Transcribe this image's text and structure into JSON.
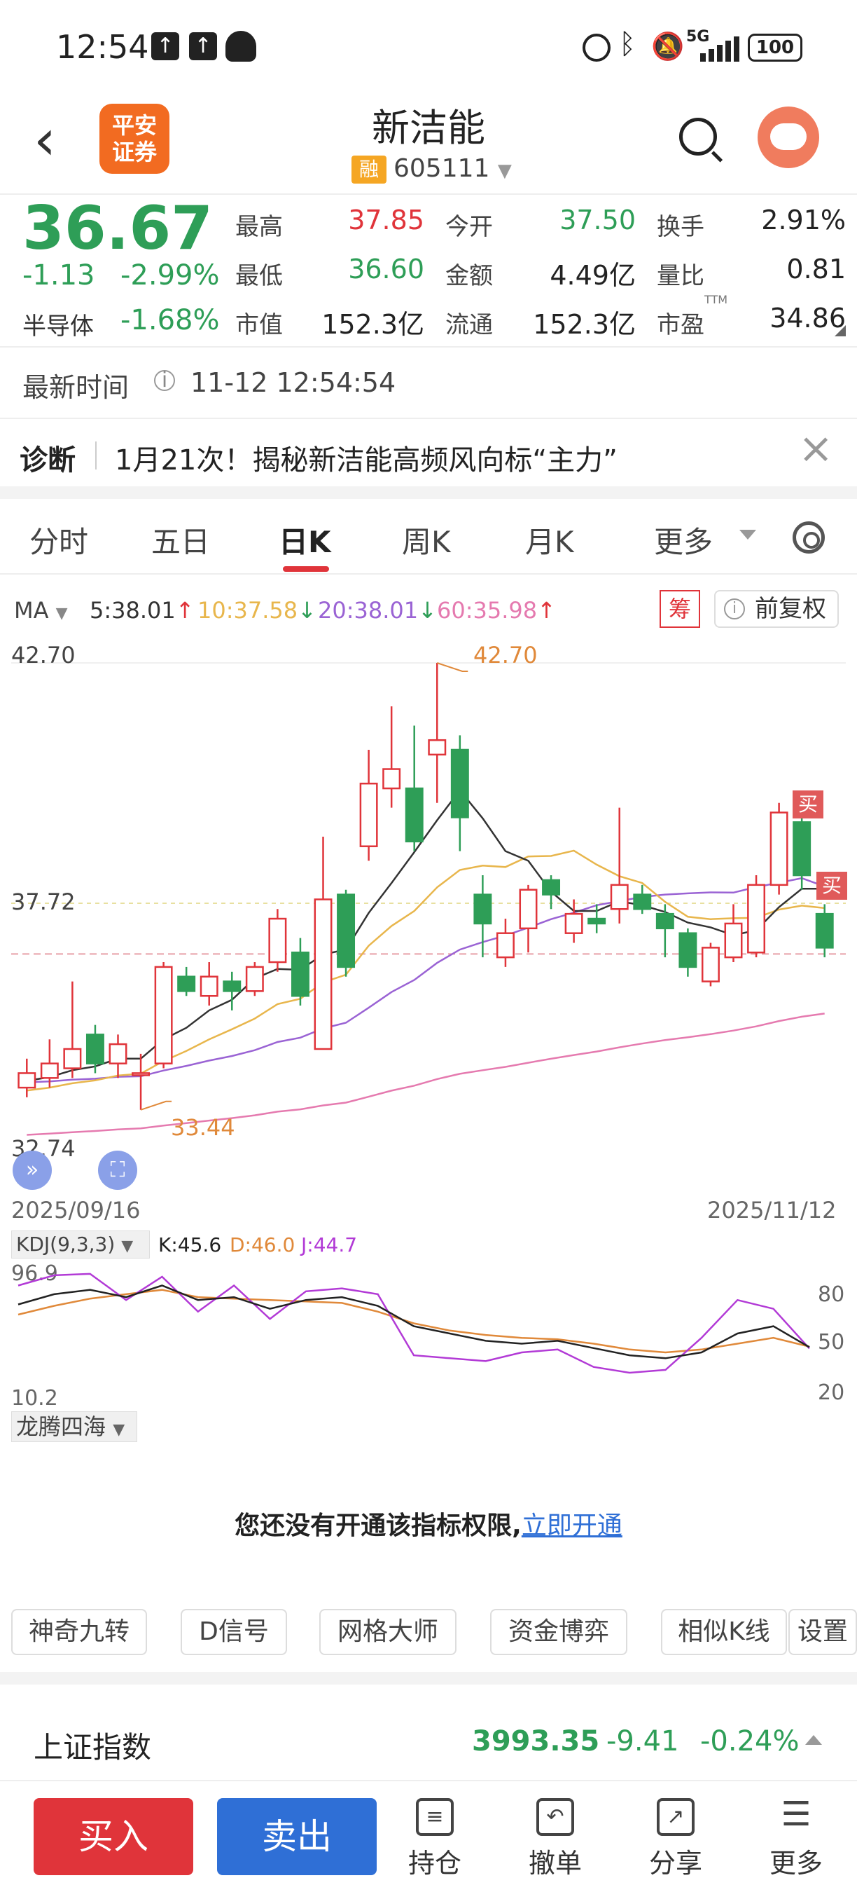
{
  "status_bar": {
    "time": "12:54",
    "icons": [
      "upload-icon",
      "upload-icon",
      "qq-icon",
      "alarm-icon",
      "bluetooth-icon",
      "mute-icon",
      "signal-icon"
    ],
    "network": "5G",
    "battery": "100"
  },
  "header": {
    "logo_text": "平安\n证券",
    "stock_name": "新洁能",
    "margin_badge": "融",
    "stock_code": "605111"
  },
  "quote": {
    "price": "36.67",
    "change": "-1.13",
    "change_pct": "-2.99%",
    "sector_name": "半导体",
    "sector_pct": "-1.68%",
    "fields": [
      {
        "label": "最高",
        "value": "37.85",
        "color": "red"
      },
      {
        "label": "今开",
        "value": "37.50",
        "color": "green"
      },
      {
        "label": "换手",
        "value": "2.91%",
        "color": "black"
      },
      {
        "label": "最低",
        "value": "36.60",
        "color": "green"
      },
      {
        "label": "金额",
        "value": "4.49亿",
        "color": "black"
      },
      {
        "label": "量比",
        "value": "0.81",
        "color": "black"
      },
      {
        "label": "市值",
        "value": "152.3亿",
        "color": "black"
      },
      {
        "label": "流通",
        "value": "152.3亿",
        "color": "black"
      },
      {
        "label": "市盈",
        "value": "34.86",
        "color": "black"
      }
    ],
    "pe_sup": "TTM"
  },
  "latest": {
    "label": "最新时间",
    "info_icon": "ⓘ",
    "time": "11-12 12:54:54"
  },
  "diagnosis": {
    "label": "诊断",
    "text": "1月21次！揭秘新洁能高频风向标“主力”"
  },
  "tabs": [
    "分时",
    "五日",
    "日K",
    "周K",
    "月K",
    "更多"
  ],
  "ma_legend": {
    "label": "MA",
    "ma5": "5:38.01",
    "ma10": "10:37.58",
    "ma20": "20:38.01",
    "ma60": "60:35.98",
    "chou": "筹",
    "fuquan": "前复权",
    "colors": {
      "ma5": "#333333",
      "ma10": "#e8b64c",
      "ma20": "#9a63d4",
      "ma60": "#e57aaf",
      "up": "#e0343a",
      "down": "#2e9e57"
    }
  },
  "chart_labels": {
    "y_top": "42.70",
    "y_mid": "37.72",
    "y_bottom": "32.74",
    "max_label": "42.70",
    "min_label": "33.44",
    "date_start": "2025/09/16",
    "date_end": "2025/11/12",
    "buy_tag": "买"
  },
  "kdj": {
    "box": "KDJ(9,3,3)",
    "k": "K:45.6",
    "d": "D:46.0",
    "j": "J:44.7",
    "y_top": "96.9",
    "y_bottom": "10.2",
    "ticks": [
      "80",
      "50",
      "20"
    ]
  },
  "indicator2": {
    "box": "龙腾四海",
    "notice": "您还没有开通该指标权限,",
    "link": "立即开通"
  },
  "tools": [
    "神奇九转",
    "D信号",
    "网格大师",
    "资金博弈",
    "相似K线",
    "设置"
  ],
  "index": {
    "name": "上证指数",
    "value": "3993.35",
    "change": "-9.41",
    "pct": "-0.24%"
  },
  "bottom_nav": {
    "buy": "买入",
    "sell": "卖出",
    "items": [
      {
        "label": "持仓",
        "icon": "holdings-icon"
      },
      {
        "label": "撤单",
        "icon": "cancel-order-icon"
      },
      {
        "label": "分享",
        "icon": "share-icon"
      },
      {
        "label": "更多",
        "icon": "menu-icon"
      }
    ]
  },
  "chart_data": {
    "type": "candlestick",
    "dates": [
      "2025/09/16",
      "2025/11/12"
    ],
    "ylim": [
      32.74,
      42.7
    ],
    "max_price": 42.7,
    "min_price": 33.44,
    "candles": [
      {
        "o": 33.9,
        "c": 34.2,
        "h": 34.5,
        "l": 33.7
      },
      {
        "o": 34.1,
        "c": 34.4,
        "h": 34.9,
        "l": 33.9
      },
      {
        "o": 34.3,
        "c": 34.7,
        "h": 36.1,
        "l": 34.1
      },
      {
        "o": 35.0,
        "c": 34.4,
        "h": 35.2,
        "l": 34.2
      },
      {
        "o": 34.4,
        "c": 34.8,
        "h": 35.0,
        "l": 34.1
      },
      {
        "o": 34.2,
        "c": 34.2,
        "h": 34.6,
        "l": 33.44
      },
      {
        "o": 34.4,
        "c": 36.4,
        "h": 36.5,
        "l": 34.3
      },
      {
        "o": 36.2,
        "c": 35.9,
        "h": 36.4,
        "l": 35.8
      },
      {
        "o": 35.8,
        "c": 36.2,
        "h": 36.5,
        "l": 35.6
      },
      {
        "o": 36.1,
        "c": 35.9,
        "h": 36.3,
        "l": 35.5
      },
      {
        "o": 35.9,
        "c": 36.4,
        "h": 36.5,
        "l": 35.8
      },
      {
        "o": 36.5,
        "c": 37.4,
        "h": 37.6,
        "l": 36.3
      },
      {
        "o": 36.7,
        "c": 35.8,
        "h": 37.0,
        "l": 35.6
      },
      {
        "o": 34.7,
        "c": 37.8,
        "h": 39.1,
        "l": 34.7
      },
      {
        "o": 37.9,
        "c": 36.4,
        "h": 38.0,
        "l": 36.2
      },
      {
        "o": 38.9,
        "c": 40.2,
        "h": 40.9,
        "l": 38.6
      },
      {
        "o": 40.1,
        "c": 40.5,
        "h": 41.8,
        "l": 39.7
      },
      {
        "o": 40.1,
        "c": 39.0,
        "h": 41.4,
        "l": 38.8
      },
      {
        "o": 40.8,
        "c": 41.1,
        "h": 42.7,
        "l": 39.8
      },
      {
        "o": 40.9,
        "c": 39.5,
        "h": 41.2,
        "l": 38.8
      },
      {
        "o": 37.9,
        "c": 37.3,
        "h": 38.3,
        "l": 36.6
      },
      {
        "o": 36.6,
        "c": 37.1,
        "h": 37.4,
        "l": 36.4
      },
      {
        "o": 37.2,
        "c": 38.0,
        "h": 38.1,
        "l": 36.7
      },
      {
        "o": 38.2,
        "c": 37.9,
        "h": 38.3,
        "l": 37.6
      },
      {
        "o": 37.1,
        "c": 37.5,
        "h": 37.8,
        "l": 36.9
      },
      {
        "o": 37.4,
        "c": 37.3,
        "h": 37.7,
        "l": 37.1
      },
      {
        "o": 37.6,
        "c": 38.1,
        "h": 39.7,
        "l": 37.3
      },
      {
        "o": 37.9,
        "c": 37.6,
        "h": 38.1,
        "l": 37.5
      },
      {
        "o": 37.5,
        "c": 37.2,
        "h": 37.7,
        "l": 36.6
      },
      {
        "o": 37.1,
        "c": 36.4,
        "h": 37.2,
        "l": 36.2
      },
      {
        "o": 36.1,
        "c": 36.8,
        "h": 36.9,
        "l": 36.0
      },
      {
        "o": 36.6,
        "c": 37.3,
        "h": 37.7,
        "l": 36.5
      },
      {
        "o": 36.7,
        "c": 38.1,
        "h": 38.3,
        "l": 36.6
      },
      {
        "o": 38.1,
        "c": 39.6,
        "h": 39.8,
        "l": 37.9
      },
      {
        "o": 39.4,
        "c": 38.3,
        "h": 39.5,
        "l": 38.0
      },
      {
        "o": 37.5,
        "c": 36.8,
        "h": 37.7,
        "l": 36.6
      }
    ],
    "kdj": {
      "ylim": [
        10.2,
        96.9
      ],
      "k": [
        75,
        82,
        85,
        80,
        88,
        78,
        80,
        72,
        78,
        80,
        74,
        60,
        55,
        50,
        48,
        50,
        45,
        40,
        38,
        42,
        55,
        60,
        45.6
      ],
      "d": [
        68,
        74,
        79,
        82,
        85,
        80,
        79,
        78,
        77,
        76,
        70,
        62,
        57,
        54,
        52,
        51,
        48,
        44,
        42,
        44,
        48,
        52,
        46.0
      ],
      "j": [
        88,
        95,
        96,
        78,
        94,
        70,
        88,
        65,
        84,
        86,
        82,
        40,
        38,
        36,
        42,
        44,
        32,
        28,
        30,
        52,
        78,
        72,
        44.7
      ]
    }
  }
}
